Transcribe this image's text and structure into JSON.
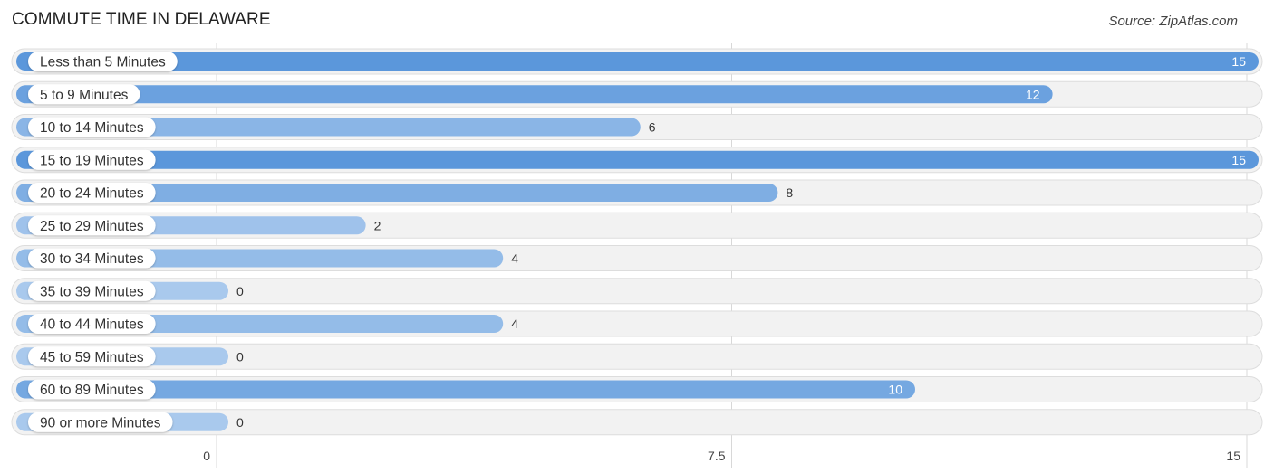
{
  "header": {
    "title": "COMMUTE TIME IN DELAWARE",
    "source": "Source: ZipAtlas.com"
  },
  "colors": {
    "bar_strong": "#5b97db",
    "bar_light": "#a9c9ed",
    "track": "#f2f2f2",
    "track_border": "#dddddd",
    "grid": "#d8d8d8"
  },
  "chart_data": {
    "type": "bar",
    "orientation": "horizontal",
    "title": "COMMUTE TIME IN DELAWARE",
    "xlabel": "",
    "ylabel": "",
    "categories": [
      "Less than 5 Minutes",
      "5 to 9 Minutes",
      "10 to 14 Minutes",
      "15 to 19 Minutes",
      "20 to 24 Minutes",
      "25 to 29 Minutes",
      "30 to 34 Minutes",
      "35 to 39 Minutes",
      "40 to 44 Minutes",
      "45 to 59 Minutes",
      "60 to 89 Minutes",
      "90 or more Minutes"
    ],
    "values": [
      15,
      12,
      6,
      15,
      8,
      2,
      4,
      0,
      4,
      0,
      10,
      0
    ],
    "xlim": [
      0,
      15
    ],
    "xticks": [
      0,
      7.5,
      15
    ],
    "xtick_labels": [
      "0",
      "7.5",
      "15"
    ],
    "grid": true,
    "legend": "none"
  }
}
